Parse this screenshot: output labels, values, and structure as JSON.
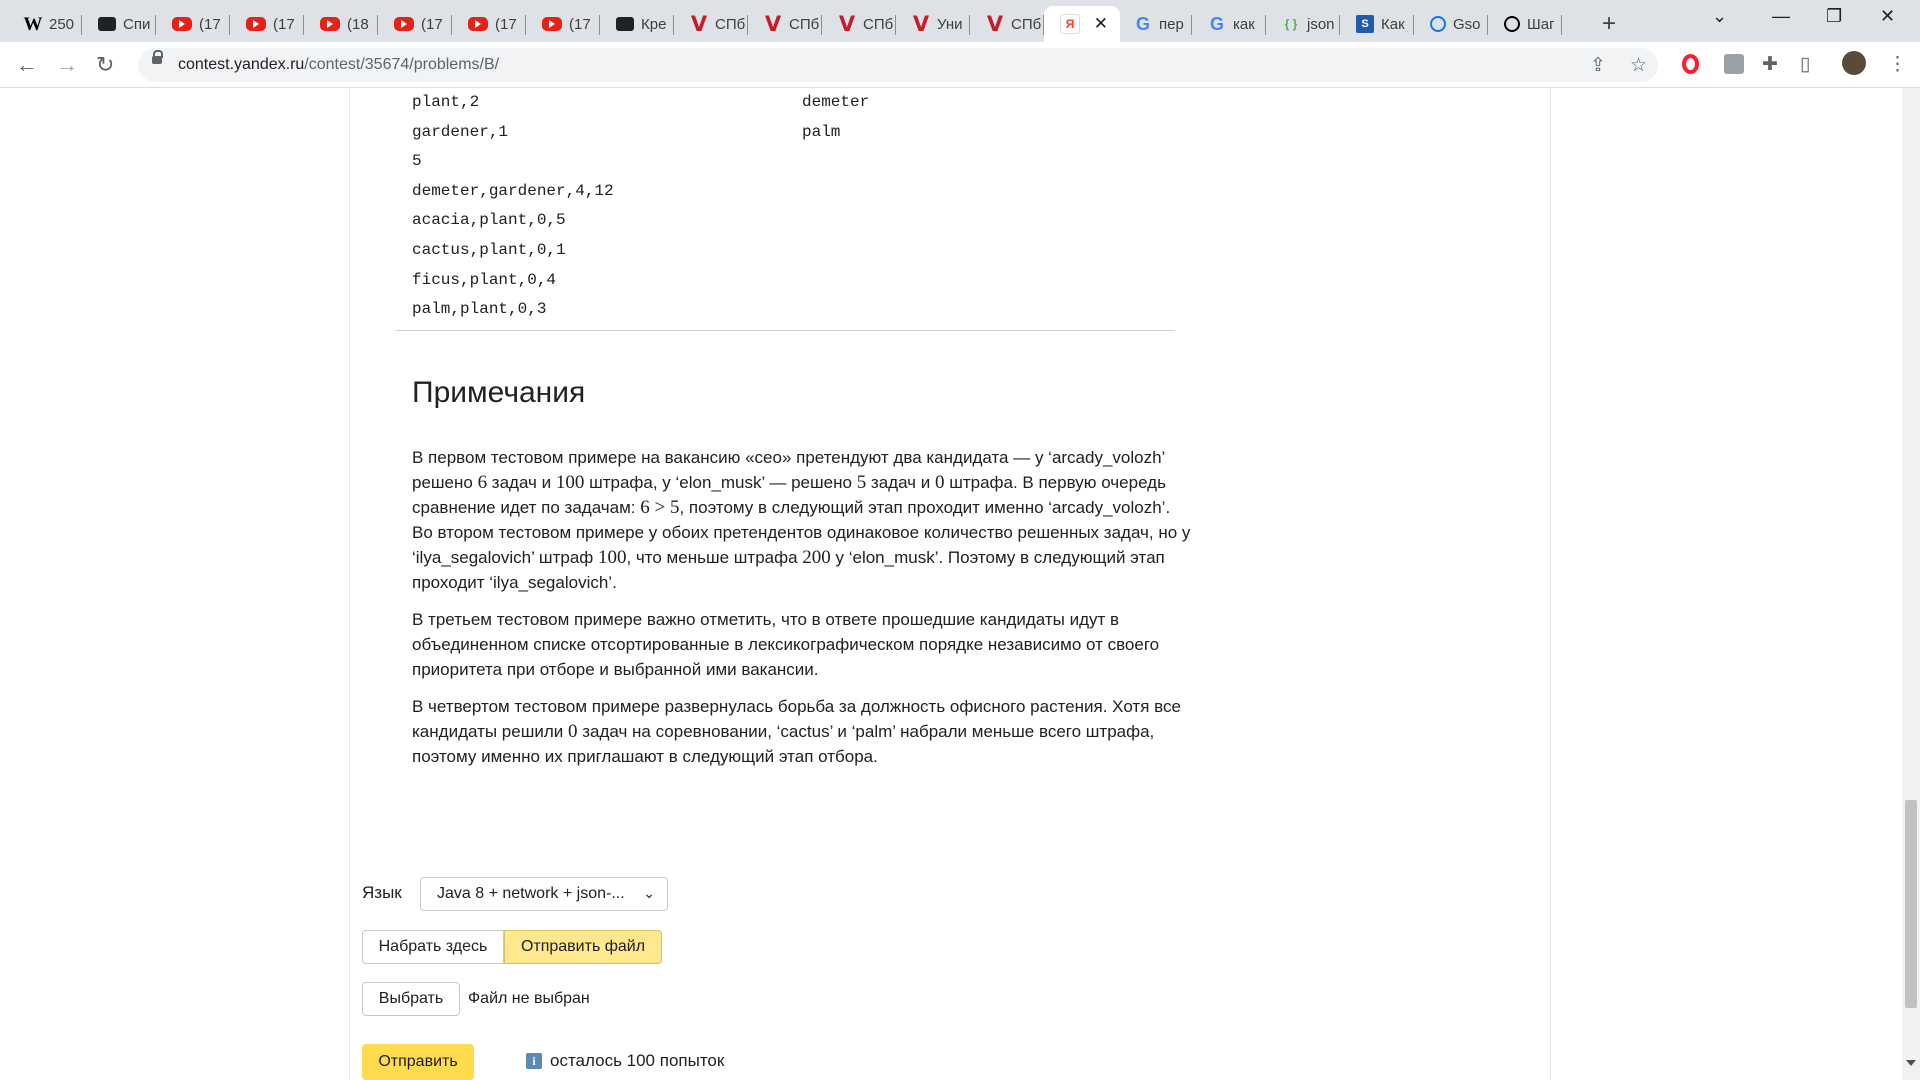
{
  "browser": {
    "tabs": [
      {
        "title": "250",
        "icon": "wikipedia-icon"
      },
      {
        "title": "Спи",
        "icon": "film-icon"
      },
      {
        "title": "(17",
        "icon": "youtube-icon"
      },
      {
        "title": "(17",
        "icon": "youtube-icon"
      },
      {
        "title": "(18",
        "icon": "youtube-icon"
      },
      {
        "title": "(17",
        "icon": "youtube-icon"
      },
      {
        "title": "(17",
        "icon": "youtube-icon"
      },
      {
        "title": "(17",
        "icon": "youtube-icon"
      },
      {
        "title": "Кре",
        "icon": "film-icon"
      },
      {
        "title": "СПб",
        "icon": "v-icon"
      },
      {
        "title": "СПб",
        "icon": "v-icon"
      },
      {
        "title": "СПб",
        "icon": "v-icon"
      },
      {
        "title": "Уни",
        "icon": "v-icon"
      },
      {
        "title": "СПб",
        "icon": "v-icon"
      },
      {
        "title": "",
        "icon": "yandex-icon",
        "active": true
      },
      {
        "title": "пер",
        "icon": "google-icon"
      },
      {
        "title": "как",
        "icon": "google-icon"
      },
      {
        "title": "json",
        "icon": "json-icon"
      },
      {
        "title": "Как",
        "icon": "stackoverflow-icon"
      },
      {
        "title": "Gso",
        "icon": "gson-icon"
      },
      {
        "title": "Шаг",
        "icon": "shag-icon"
      }
    ],
    "url_host": "contest.yandex.ru",
    "url_path": "/contest/35674/problems/B/",
    "new_tab_label": "+",
    "close_label": "✕"
  },
  "samples": {
    "input_lines": [
      "plant,2",
      "gardener,1",
      "5",
      "demeter,gardener,4,12",
      "acacia,plant,0,5",
      "cactus,plant,0,1",
      "ficus,plant,0,4",
      "palm,plant,0,3"
    ],
    "output_lines": [
      "demeter",
      "palm"
    ]
  },
  "notes": {
    "title": "Примечания",
    "p1": {
      "a": "В первом тестовом примере на вакансию «ceo» претендуют два кандидата — у ‘arcady_volozh’ решено ",
      "m1": "6",
      "b": " задач и ",
      "m2": "100",
      "c": " штрафа, у ‘elon_musk’ — решено ",
      "m3": "5",
      "d": " задач и ",
      "m4": "0",
      "e": " штрафа. В первую очередь сравнение идет по задачам: ",
      "m5": "6 > 5",
      "f": ", поэтому в следующий этап проходит именно ‘arcady_volozh’."
    },
    "p1b": {
      "a": "Во втором тестовом примере у обоих претендентов одинаковое количество решенных задач, но у ‘ilya_segalovich’ штраф ",
      "m1": "100",
      "b": ", что меньше штрафа ",
      "m2": "200",
      "c": " у ‘elon_musk’. Поэтому в следующий этап проходит ‘ilya_segalovich’."
    },
    "p2": "В третьем тестовом примере важно отметить, что в ответе прошедшие кандидаты идут в объединенном списке отсортированные в лексикографическом порядке независимо от своего приоритета при отборе и выбранной ими вакансии.",
    "p3": {
      "a": "В четвертом тестовом примере развернулась борьба за должность офисного растения. Хотя все кандидаты решили ",
      "m1": "0",
      "b": " задач на соревновании, ‘cactus’ и ‘palm’ набрали меньше всего штрафа, поэтому именно их приглашают в следующий этап отбора."
    }
  },
  "submit_form": {
    "language_label": "Язык",
    "language_value": "Java 8 + network + json-...",
    "tab_type_here": "Набрать здесь",
    "tab_send_file": "Отправить файл",
    "choose_button": "Выбрать",
    "file_status": "Файл не выбран",
    "submit_button": "Отправить",
    "attempts_text": "осталось 100 попыток"
  }
}
